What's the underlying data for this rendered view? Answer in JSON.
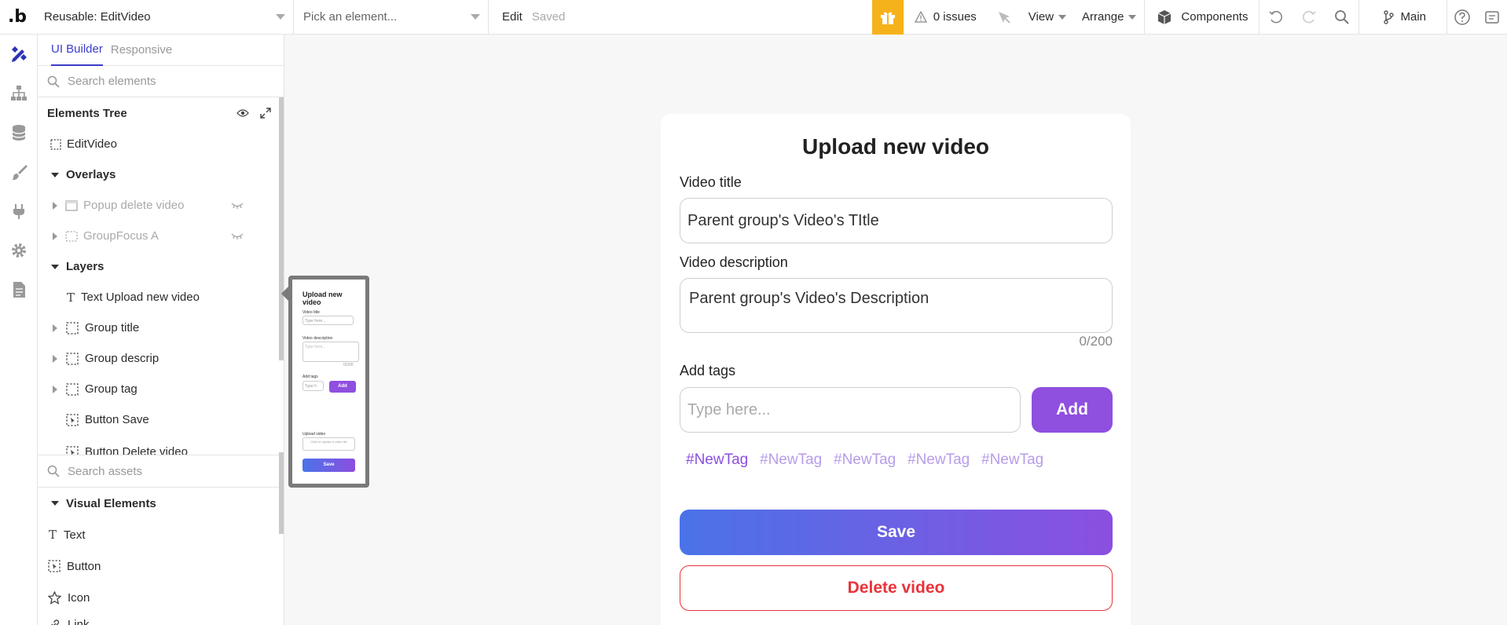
{
  "topbar": {
    "logo": ".b",
    "page_selector": "Reusable: EditVideo",
    "element_picker_placeholder": "Pick an element...",
    "edit_label": "Edit",
    "saved_label": "Saved",
    "issues_label": "0 issues",
    "view_label": "View",
    "arrange_label": "Arrange",
    "components_label": "Components",
    "branch_label": "Main"
  },
  "panel": {
    "tabs": [
      "UI Builder",
      "Responsive"
    ],
    "search_placeholder": "Search elements",
    "tree_title": "Elements Tree",
    "tree": {
      "root": "EditVideo",
      "overlays": "Overlays",
      "popup": "Popup delete video",
      "groupfocus": "GroupFocus A",
      "layers": "Layers",
      "text_upload": "Text Upload new video",
      "group_title": "Group title",
      "group_descrip": "Group descrip",
      "group_tag": "Group tag",
      "button_save": "Button Save",
      "button_delete": "Button Delete video"
    },
    "assets_search_placeholder": "Search assets",
    "visual_elements": "Visual Elements",
    "visual": {
      "text": "Text",
      "button": "Button",
      "icon": "Icon",
      "link": "Link"
    }
  },
  "mini": {
    "title": "Upload new video",
    "video_title": "Video title",
    "type_here": "Type here...",
    "video_description": "Video description",
    "counter": "0/200",
    "add_tags": "Add tags",
    "tag_input": "Type h",
    "add": "Add",
    "upload_video": "Upload video",
    "upload_hint": "Click to upload a video file",
    "save": "Save"
  },
  "card": {
    "title": "Upload new video",
    "video_title_label": "Video title",
    "video_title_value": "Parent group's Video's TItle",
    "video_description_label": "Video description",
    "video_description_value": "Parent group's Video's Description",
    "counter": "0/200",
    "add_tags_label": "Add tags",
    "tag_placeholder": "Type here...",
    "add_button": "Add",
    "tags": [
      "#NewTag",
      "#NewTag",
      "#NewTag",
      "#NewTag",
      "#NewTag"
    ],
    "save_button": "Save",
    "delete_button": "Delete video"
  },
  "colors": {
    "accent": "#3a3cc9",
    "purple": "#8f4fdf",
    "gift": "#f6b21a",
    "danger": "#e8333a"
  }
}
